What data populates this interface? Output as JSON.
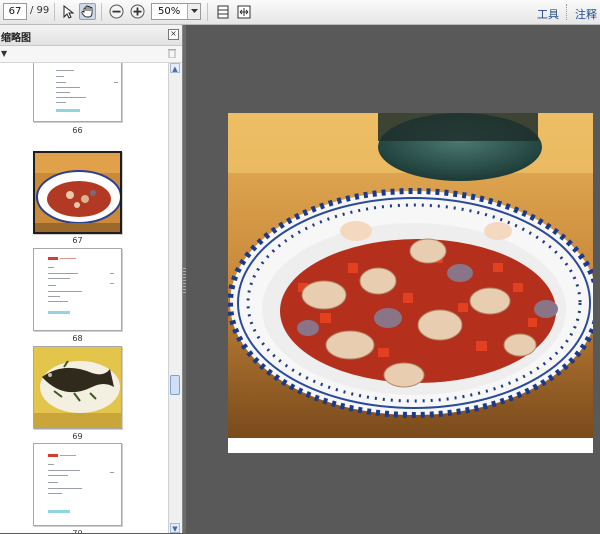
{
  "toolbar": {
    "page_current": "67",
    "page_total": "/ 99",
    "zoom_value": "50%",
    "tools_label": "工具",
    "comment_label": "注释"
  },
  "panel": {
    "title": "缩略图"
  },
  "thumbnails": [
    {
      "label": "66"
    },
    {
      "label": "67"
    },
    {
      "label": "68"
    },
    {
      "label": "69"
    },
    {
      "label": "70"
    }
  ],
  "colors": {
    "workspace": "#595959",
    "link": "#1c4b8c",
    "plate_rim": "#1d3a8a"
  },
  "icons": [
    "select-arrow-icon",
    "hand-icon",
    "zoom-out-icon",
    "zoom-in-icon",
    "fit-page-icon",
    "fit-width-icon",
    "close-icon",
    "trash-icon",
    "options-arrow-icon"
  ]
}
